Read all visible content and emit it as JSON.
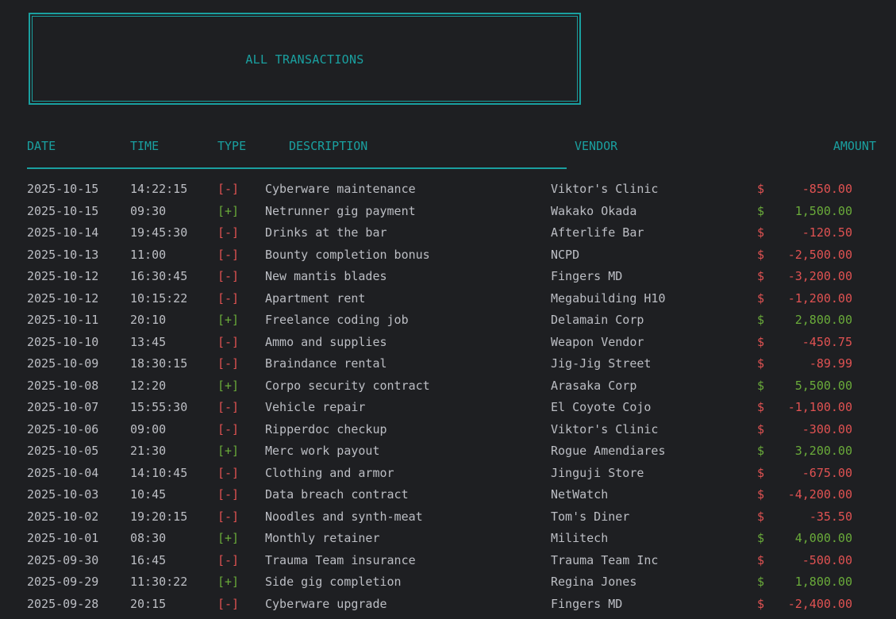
{
  "title": "ALL TRANSACTIONS",
  "columns": {
    "date": "DATE",
    "time": "TIME",
    "type": "TYPE",
    "description": "DESCRIPTION",
    "vendor": "VENDOR",
    "amount": "AMOUNT"
  },
  "colors": {
    "accent": "#1aa0a0",
    "negative": "#e05252",
    "positive": "#6aab3a",
    "text": "#bcbec4",
    "background": "#1e1f22"
  },
  "currency_symbol": "$",
  "transactions": [
    {
      "date": "2025-10-15",
      "time": "14:22:15",
      "type": "[-]",
      "description": "Cyberware maintenance",
      "vendor": "Viktor's Clinic",
      "amount": "-850.00",
      "sign": "neg"
    },
    {
      "date": "2025-10-15",
      "time": "09:30",
      "type": "[+]",
      "description": "Netrunner gig payment",
      "vendor": "Wakako Okada",
      "amount": "1,500.00",
      "sign": "pos"
    },
    {
      "date": "2025-10-14",
      "time": "19:45:30",
      "type": "[-]",
      "description": "Drinks at the bar",
      "vendor": "Afterlife Bar",
      "amount": "-120.50",
      "sign": "neg"
    },
    {
      "date": "2025-10-13",
      "time": "11:00",
      "type": "[-]",
      "description": "Bounty completion bonus",
      "vendor": "NCPD",
      "amount": "-2,500.00",
      "sign": "neg"
    },
    {
      "date": "2025-10-12",
      "time": "16:30:45",
      "type": "[-]",
      "description": "New mantis blades",
      "vendor": "Fingers MD",
      "amount": "-3,200.00",
      "sign": "neg"
    },
    {
      "date": "2025-10-12",
      "time": "10:15:22",
      "type": "[-]",
      "description": "Apartment rent",
      "vendor": "Megabuilding H10",
      "amount": "-1,200.00",
      "sign": "neg"
    },
    {
      "date": "2025-10-11",
      "time": "20:10",
      "type": "[+]",
      "description": "Freelance coding job",
      "vendor": "Delamain Corp",
      "amount": "2,800.00",
      "sign": "pos"
    },
    {
      "date": "2025-10-10",
      "time": "13:45",
      "type": "[-]",
      "description": "Ammo and supplies",
      "vendor": "Weapon Vendor",
      "amount": "-450.75",
      "sign": "neg"
    },
    {
      "date": "2025-10-09",
      "time": "18:30:15",
      "type": "[-]",
      "description": "Braindance rental",
      "vendor": "Jig-Jig Street",
      "amount": "-89.99",
      "sign": "neg"
    },
    {
      "date": "2025-10-08",
      "time": "12:20",
      "type": "[+]",
      "description": "Corpo security contract",
      "vendor": "Arasaka Corp",
      "amount": "5,500.00",
      "sign": "pos"
    },
    {
      "date": "2025-10-07",
      "time": "15:55:30",
      "type": "[-]",
      "description": "Vehicle repair",
      "vendor": "El Coyote Cojo",
      "amount": "-1,100.00",
      "sign": "neg"
    },
    {
      "date": "2025-10-06",
      "time": "09:00",
      "type": "[-]",
      "description": "Ripperdoc checkup",
      "vendor": "Viktor's Clinic",
      "amount": "-300.00",
      "sign": "neg"
    },
    {
      "date": "2025-10-05",
      "time": "21:30",
      "type": "[+]",
      "description": "Merc work payout",
      "vendor": "Rogue Amendiares",
      "amount": "3,200.00",
      "sign": "pos"
    },
    {
      "date": "2025-10-04",
      "time": "14:10:45",
      "type": "[-]",
      "description": "Clothing and armor",
      "vendor": "Jinguji Store",
      "amount": "-675.00",
      "sign": "neg"
    },
    {
      "date": "2025-10-03",
      "time": "10:45",
      "type": "[-]",
      "description": "Data breach contract",
      "vendor": "NetWatch",
      "amount": "-4,200.00",
      "sign": "neg"
    },
    {
      "date": "2025-10-02",
      "time": "19:20:15",
      "type": "[-]",
      "description": "Noodles and synth-meat",
      "vendor": "Tom's Diner",
      "amount": "-35.50",
      "sign": "neg"
    },
    {
      "date": "2025-10-01",
      "time": "08:30",
      "type": "[+]",
      "description": "Monthly retainer",
      "vendor": "Militech",
      "amount": "4,000.00",
      "sign": "pos"
    },
    {
      "date": "2025-09-30",
      "time": "16:45",
      "type": "[-]",
      "description": "Trauma Team insurance",
      "vendor": "Trauma Team Inc",
      "amount": "-500.00",
      "sign": "neg"
    },
    {
      "date": "2025-09-29",
      "time": "11:30:22",
      "type": "[+]",
      "description": "Side gig completion",
      "vendor": "Regina Jones",
      "amount": "1,800.00",
      "sign": "pos"
    },
    {
      "date": "2025-09-28",
      "time": "20:15",
      "type": "[-]",
      "description": "Cyberware upgrade",
      "vendor": "Fingers MD",
      "amount": "-2,400.00",
      "sign": "neg"
    }
  ]
}
